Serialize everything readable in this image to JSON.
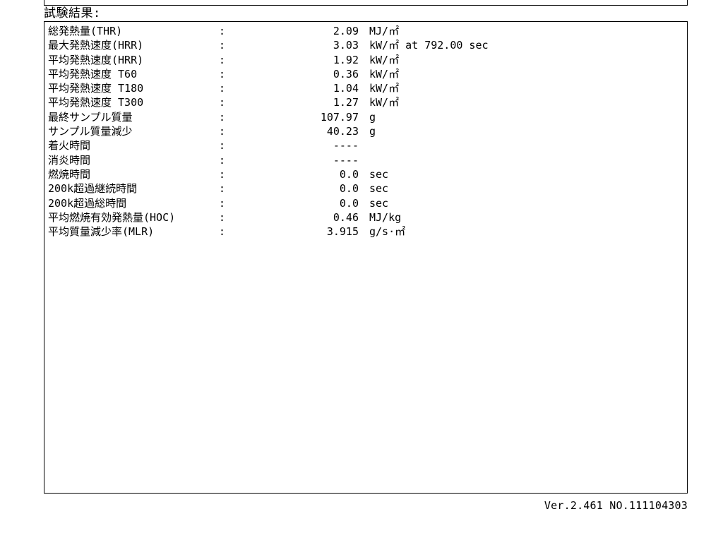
{
  "section_title": "試験結果:",
  "rows": [
    {
      "label": "総発熱量(THR)",
      "colon": ":",
      "value": "2.09",
      "unit": "MJ/㎡"
    },
    {
      "label": "最大発熱速度(HRR)",
      "colon": ":",
      "value": "3.03",
      "unit": "kW/㎡ at 792.00 sec"
    },
    {
      "label": "平均発熱速度(HRR)",
      "colon": ":",
      "value": "1.92",
      "unit": "kW/㎡"
    },
    {
      "label": "平均発熱速度 T60",
      "colon": ":",
      "value": "0.36",
      "unit": "kW/㎡"
    },
    {
      "label": "平均発熱速度 T180",
      "colon": ":",
      "value": "1.04",
      "unit": "kW/㎡"
    },
    {
      "label": "平均発熱速度 T300",
      "colon": ":",
      "value": "1.27",
      "unit": "kW/㎡"
    },
    {
      "label": "最終サンプル質量",
      "colon": ":",
      "value": "107.97",
      "unit": "g"
    },
    {
      "label": "サンプル質量減少",
      "colon": ":",
      "value": "40.23",
      "unit": "g"
    },
    {
      "label": "着火時間",
      "colon": ":",
      "value": "----",
      "unit": ""
    },
    {
      "label": "消炎時間",
      "colon": ":",
      "value": "----",
      "unit": ""
    },
    {
      "label": "燃焼時間",
      "colon": ":",
      "value": "0.0",
      "unit": "sec"
    },
    {
      "label": "200k超過継続時間",
      "colon": ":",
      "value": "0.0",
      "unit": "sec"
    },
    {
      "label": "200k超過総時間",
      "colon": ":",
      "value": "0.0",
      "unit": "sec"
    },
    {
      "label": "平均燃焼有効発熱量(HOC)",
      "colon": ":",
      "value": "0.46",
      "unit": "MJ/kg"
    },
    {
      "label": "平均質量減少率(MLR)",
      "colon": ":",
      "value": "3.915",
      "unit": "g/s·㎡"
    }
  ],
  "footer": "Ver.2.461 NO.111104303"
}
